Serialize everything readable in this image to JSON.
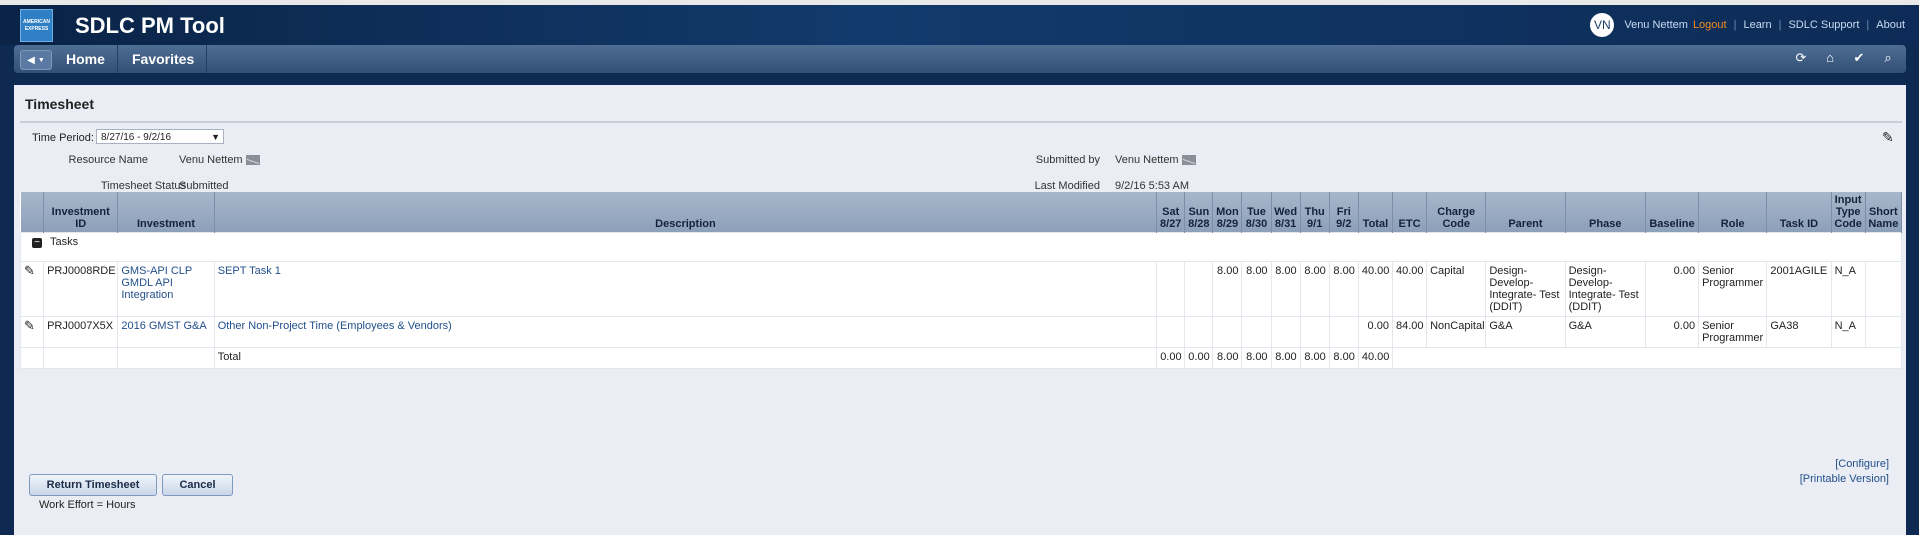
{
  "app": {
    "logo_text": "AMERICAN EXPRESS",
    "title": "SDLC PM Tool",
    "user_initials": "VN",
    "user_name": "Venu Nettem",
    "logout": "Logout",
    "links": [
      "Learn",
      "SDLC Support",
      "About"
    ]
  },
  "nav": {
    "items": [
      "Home",
      "Favorites"
    ],
    "icons": [
      "refresh-icon",
      "home-icon",
      "check-icon",
      "search-icon"
    ]
  },
  "page": {
    "title": "Timesheet",
    "time_period_label": "Time Period:",
    "time_period_value": "8/27/16 - 9/2/16",
    "resource_name_label": "Resource Name",
    "resource_name": "Venu Nettem",
    "submitted_by_label": "Submitted by",
    "submitted_by": "Venu Nettem",
    "status_label": "Timesheet Status",
    "status": "Submitted",
    "last_modified_label": "Last Modified",
    "last_modified": "9/2/16 5:53 AM"
  },
  "table": {
    "headers": {
      "investment_id": "Investment ID",
      "investment": "Investment",
      "description": "Description",
      "sat": "Sat 8/27",
      "sun": "Sun 8/28",
      "mon": "Mon 8/29",
      "tue": "Tue 8/30",
      "wed": "Wed 8/31",
      "thu": "Thu 9/1",
      "fri": "Fri 9/2",
      "total": "Total",
      "etc": "ETC",
      "charge_code": "Charge Code",
      "parent": "Parent",
      "phase": "Phase",
      "baseline": "Baseline",
      "role": "Role",
      "task_id": "Task ID",
      "input_type_code": "Input Type Code",
      "short_name": "Short Name"
    },
    "group_label": "Tasks",
    "rows": [
      {
        "investment_id": "PRJ0008RDE",
        "investment": "GMS-API CLP GMDL API Integration",
        "description": "SEPT Task 1",
        "sat": "",
        "sun": "",
        "mon": "8.00",
        "tue": "8.00",
        "wed": "8.00",
        "thu": "8.00",
        "fri": "8.00",
        "total": "40.00",
        "etc": "40.00",
        "charge_code": "Capital",
        "parent": "Design-Develop-Integrate- Test (DDIT)",
        "phase": "Design-Develop-Integrate- Test (DDIT)",
        "baseline": "0.00",
        "role": "Senior Programmer",
        "task_id": "2001AGILE",
        "input_type_code": "N_A",
        "short_name": ""
      },
      {
        "investment_id": "PRJ0007X5X",
        "investment": "2016 GMST G&A",
        "description": "Other Non-Project Time (Employees & Vendors)",
        "sat": "",
        "sun": "",
        "mon": "",
        "tue": "",
        "wed": "",
        "thu": "",
        "fri": "",
        "total": "0.00",
        "etc": "84.00",
        "charge_code": "NonCapital",
        "parent": "G&A",
        "phase": "G&A",
        "baseline": "0.00",
        "role": "Senior Programmer",
        "task_id": "GA38",
        "input_type_code": "N_A",
        "short_name": ""
      }
    ],
    "totals": {
      "label": "Total",
      "sat": "0.00",
      "sun": "0.00",
      "mon": "8.00",
      "tue": "8.00",
      "wed": "8.00",
      "thu": "8.00",
      "fri": "8.00",
      "total": "40.00"
    }
  },
  "actions": {
    "return": "Return Timesheet",
    "cancel": "Cancel",
    "configure": "[Configure]",
    "printable": "[Printable Version]",
    "work_effort": "Work Effort = Hours"
  }
}
